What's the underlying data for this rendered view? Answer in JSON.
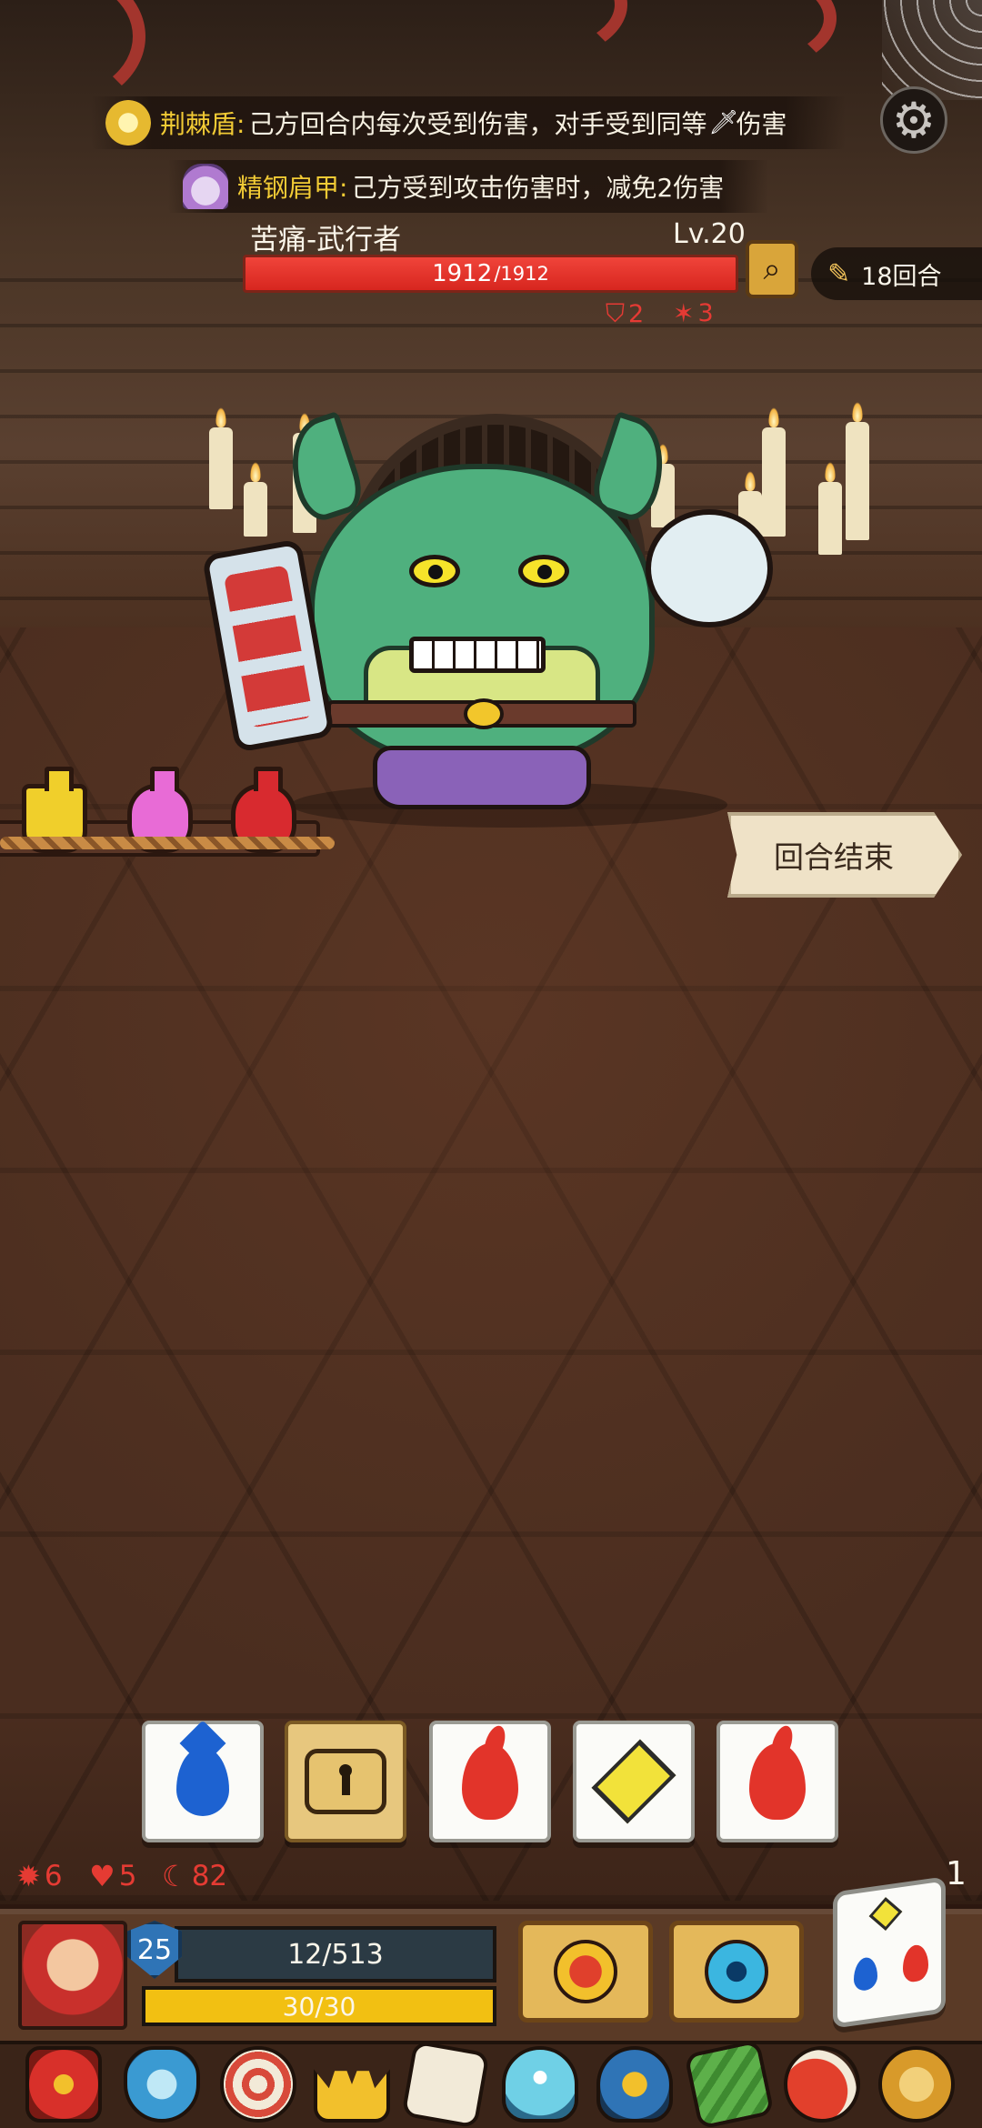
{
  "buffs": [
    {
      "name": "荆棘盾:",
      "desc_before": "己方回合内每次受到伤害，对手受到同等",
      "desc_after": "伤害",
      "icon": "sun-shield-icon"
    },
    {
      "name": "精钢肩甲:",
      "desc": "己方受到攻击伤害时，减免2伤害",
      "icon": "steel-pauldron-icon"
    }
  ],
  "settings_icon": "gear-icon",
  "enemy": {
    "name": "苦痛-武行者",
    "level": "Lv.20",
    "hp": "1912",
    "hp_max": "/1912",
    "hp_fraction": 1.0,
    "shield_stat": "2",
    "attack_stat": "3",
    "inspect_icon": "magnifier-icon"
  },
  "round": {
    "label": "18回合",
    "icon": "scroll-icon"
  },
  "potions": [
    {
      "name": "yellow-potion",
      "color": "#f0cf2b"
    },
    {
      "name": "pink-potion",
      "color": "#e86bd6"
    },
    {
      "name": "red-potion",
      "color": "#d82a2f"
    }
  ],
  "end_turn": {
    "label": "回合结束"
  },
  "dice_slots": [
    {
      "face": "water-drop-icon",
      "locked": false
    },
    {
      "face": "lock-icon",
      "locked": true
    },
    {
      "face": "fire-icon",
      "locked": false
    },
    {
      "face": "diamond-icon",
      "locked": false
    },
    {
      "face": "fire-icon",
      "locked": false
    }
  ],
  "player_stats": {
    "gear": "6",
    "heart": "5",
    "rune": "82",
    "dice_remaining": "1"
  },
  "player": {
    "level": "25",
    "hp": "12/513",
    "energy": "30/30",
    "energy_fraction": 1.0,
    "skills": [
      "sun-dice-skill-icon",
      "water-orb-skill-icon"
    ]
  },
  "relics": [
    "dragon-staff-icon",
    "blue-shield-icon",
    "round-shield-icon",
    "golden-crown-icon",
    "spiked-dice-icon",
    "slime-ghost-icon",
    "turtle-shell-icon",
    "green-tablet-icon",
    "meat-leg-icon",
    "lion-head-icon"
  ],
  "colors": {
    "hp_red": "#e0302a",
    "energy_yellow": "#f2c012",
    "buff_name_yellow": "#f2cb35",
    "stat_red": "#e53b33"
  }
}
